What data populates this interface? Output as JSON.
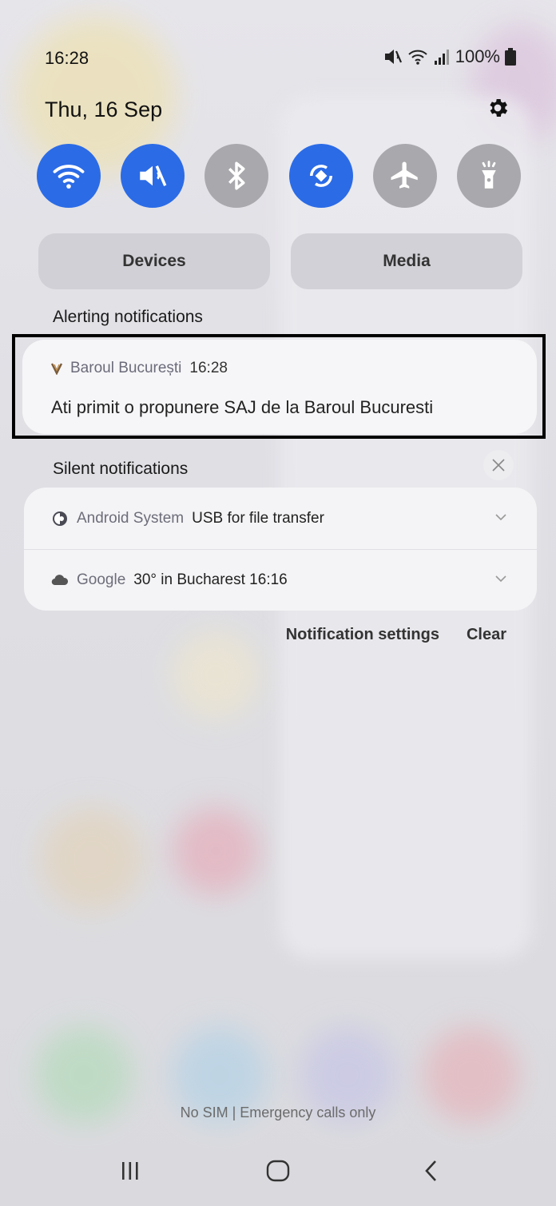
{
  "status_bar": {
    "time": "16:28",
    "battery_text": "100%",
    "icons": [
      "mute-icon",
      "wifi-icon",
      "signal-icon",
      "battery-icon"
    ]
  },
  "header": {
    "date": "Thu, 16 Sep",
    "settings_icon": "gear-icon"
  },
  "quick_settings": [
    {
      "name": "Wi-Fi",
      "icon": "wifi-icon",
      "state": "on"
    },
    {
      "name": "Mute",
      "icon": "mute-icon",
      "state": "on"
    },
    {
      "name": "Bluetooth",
      "icon": "bluetooth-icon",
      "state": "off"
    },
    {
      "name": "Auto rotate",
      "icon": "rotate-icon",
      "state": "on"
    },
    {
      "name": "Airplane mode",
      "icon": "airplane-icon",
      "state": "off"
    },
    {
      "name": "Flashlight",
      "icon": "flashlight-icon",
      "state": "off"
    }
  ],
  "pills": {
    "devices": "Devices",
    "media": "Media"
  },
  "alerting": {
    "label": "Alerting notifications",
    "notification": {
      "app": "Baroul București",
      "time": "16:28",
      "body": "Ati primit o propunere SAJ de la Baroul Bucuresti"
    }
  },
  "silent": {
    "label": "Silent notifications",
    "notifications": [
      {
        "app": "Android System",
        "message": "USB for file transfer"
      },
      {
        "app": "Google",
        "message": "30° in Bucharest  16:16"
      }
    ]
  },
  "actions": {
    "settings": "Notification settings",
    "clear": "Clear"
  },
  "footer": {
    "sim_status": "No SIM | Emergency calls only"
  },
  "colors": {
    "accent": "#2b6be6",
    "toggle_off": "#a9a9ad",
    "highlight_border": "#000000"
  }
}
